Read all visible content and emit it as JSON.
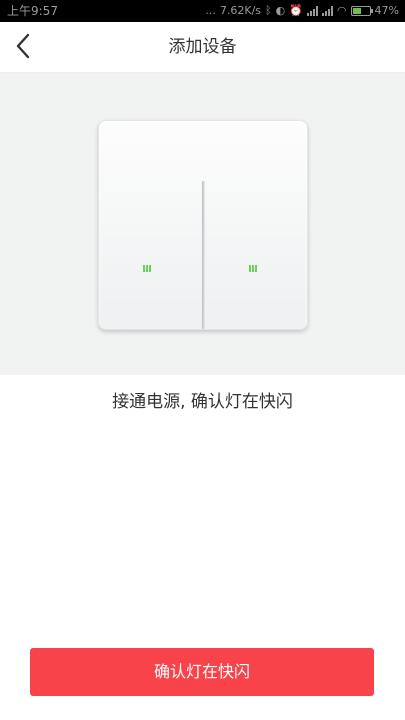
{
  "status_bar": {
    "time": "上午9:57",
    "dots": "...",
    "network_speed": "7.62K/s",
    "battery_percent": "47%",
    "icons": [
      "bluetooth-icon",
      "toggle-icon",
      "alarm-icon",
      "signal-icon",
      "signal-icon",
      "wifi-icon",
      "battery-icon"
    ]
  },
  "nav": {
    "title": "添加设备",
    "back_icon": "chevron-left-icon"
  },
  "main": {
    "instruction": "接通电源, 确认灯在快闪",
    "confirm_label": "确认灯在快闪"
  },
  "colors": {
    "accent": "#f9434b",
    "indicator": "#6cd05a",
    "hero_background": "#f1f2f2"
  }
}
